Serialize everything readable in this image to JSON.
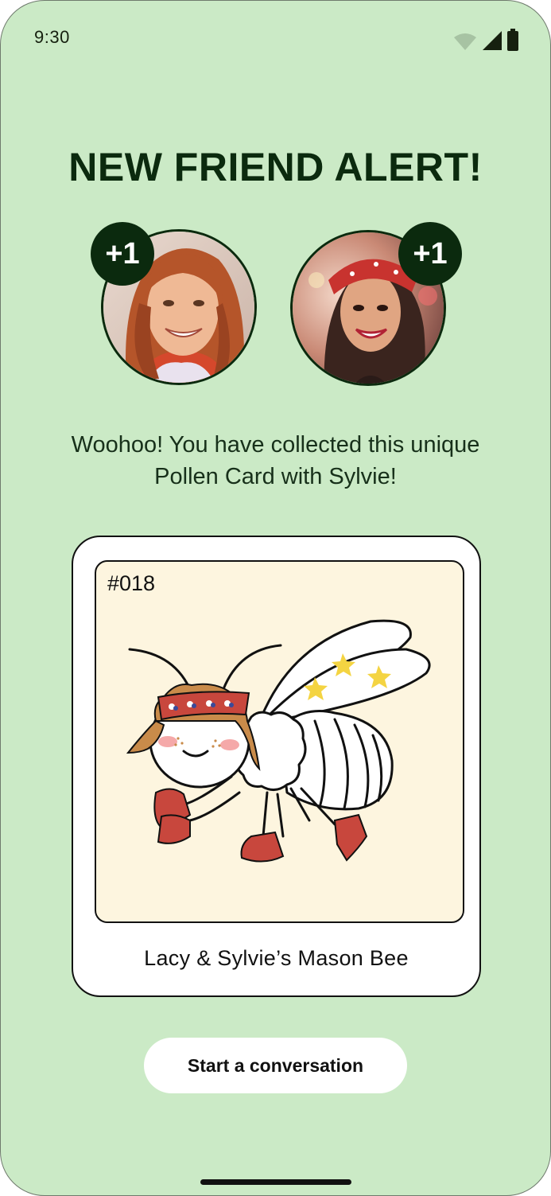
{
  "status_bar": {
    "time": "9:30",
    "icons": [
      "wifi-icon",
      "signal-icon",
      "battery-icon"
    ]
  },
  "headline": "NEW FRIEND ALERT!",
  "avatars": [
    {
      "badge": "+1",
      "description": "user-avatar"
    },
    {
      "badge": "+1",
      "description": "friend-avatar"
    }
  ],
  "message": "Woohoo! You have collected this unique Pollen Card with Sylvie!",
  "card": {
    "number": "#018",
    "title": "Lacy & Sylvie’s Mason Bee"
  },
  "cta": {
    "label": "Start a conversation"
  },
  "colors": {
    "background": "#cbeac6",
    "dark_green": "#0b2a0e",
    "card_art_bg": "#fdf5df"
  }
}
